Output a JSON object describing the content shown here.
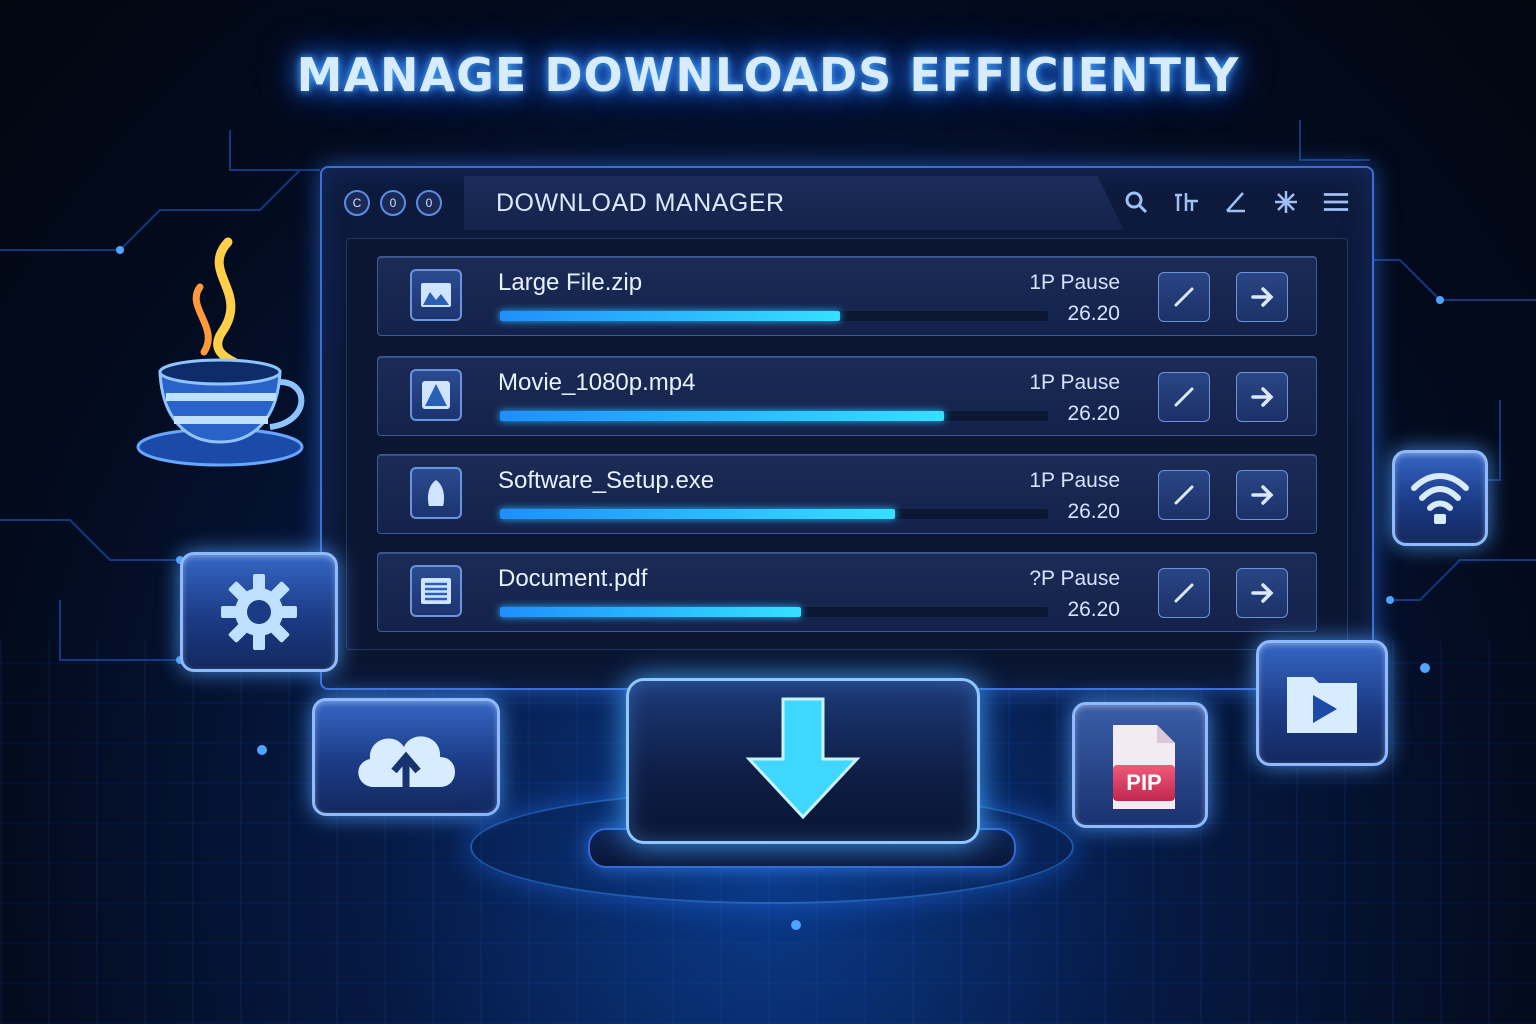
{
  "headline": "MANAGE DOWNLOADS EFFICIENTLY",
  "window": {
    "title": "DOWNLOAD MANAGER",
    "controls": [
      "C",
      "0",
      "0"
    ]
  },
  "downloads": [
    {
      "name": "Large File.zip",
      "state": "1P Pause",
      "time": "26.20",
      "progress": 0.62,
      "icon": "image-file-icon"
    },
    {
      "name": "Movie_1080p.mp4",
      "state": "1P Pause",
      "time": "26.20",
      "progress": 0.81,
      "icon": "video-file-icon"
    },
    {
      "name": "Software_Setup.exe",
      "state": "1P Pause",
      "time": "26.20",
      "progress": 0.72,
      "icon": "app-file-icon"
    },
    {
      "name": "Document.pdf",
      "state": "?P Pause",
      "time": "26.20",
      "progress": 0.55,
      "icon": "document-file-icon"
    }
  ],
  "pdf_badge": "PIP",
  "colors": {
    "accent": "#35e0ff",
    "brand": "#2b7fff",
    "pdf": "#d63a5e"
  }
}
